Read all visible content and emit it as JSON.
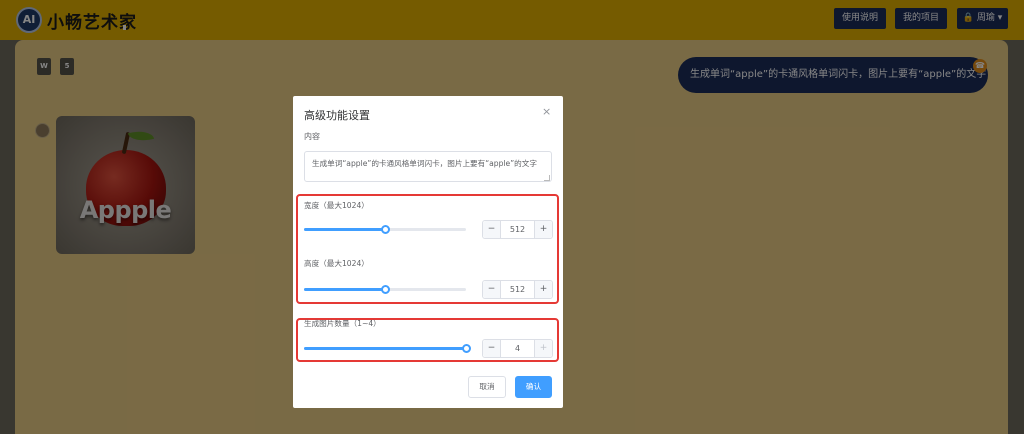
{
  "header": {
    "logo_text": "AI",
    "app_name": "小畅艺术家",
    "usage_button": "使用说明",
    "projects_button": "我的项目",
    "user_button": "周瑜"
  },
  "workspace": {
    "file_icons": [
      {
        "label": "W",
        "icon": "word-file-icon"
      },
      {
        "label": "5",
        "icon": "html5-file-icon"
      }
    ],
    "user_message": "生成单词“apple”的卡通风格单词闪卡，图片上要有“apple”的文字",
    "generated_image_text": "Appple"
  },
  "dialog": {
    "title": "高级功能设置",
    "close_icon": "×",
    "content_label": "内容",
    "prompt_value": "生成单词“apple”的卡通风格单词闪卡，图片上要有“apple”的文字",
    "width": {
      "label": "宽度（最大1024）",
      "value": "512",
      "max": 1024,
      "fraction": 0.5
    },
    "height": {
      "label": "高度（最大1024）",
      "value": "512",
      "max": 1024,
      "fraction": 0.5
    },
    "count": {
      "label": "生成图片数量（1~4）",
      "value": "4",
      "max": 4,
      "fraction": 1.0
    },
    "minus_symbol": "−",
    "plus_symbol": "+",
    "cancel_button": "取消",
    "confirm_button": "确认"
  },
  "colors": {
    "header": "#e1ae00",
    "brand_dark": "#1b2c59",
    "primary": "#409eff",
    "highlight_border": "#e53935"
  }
}
